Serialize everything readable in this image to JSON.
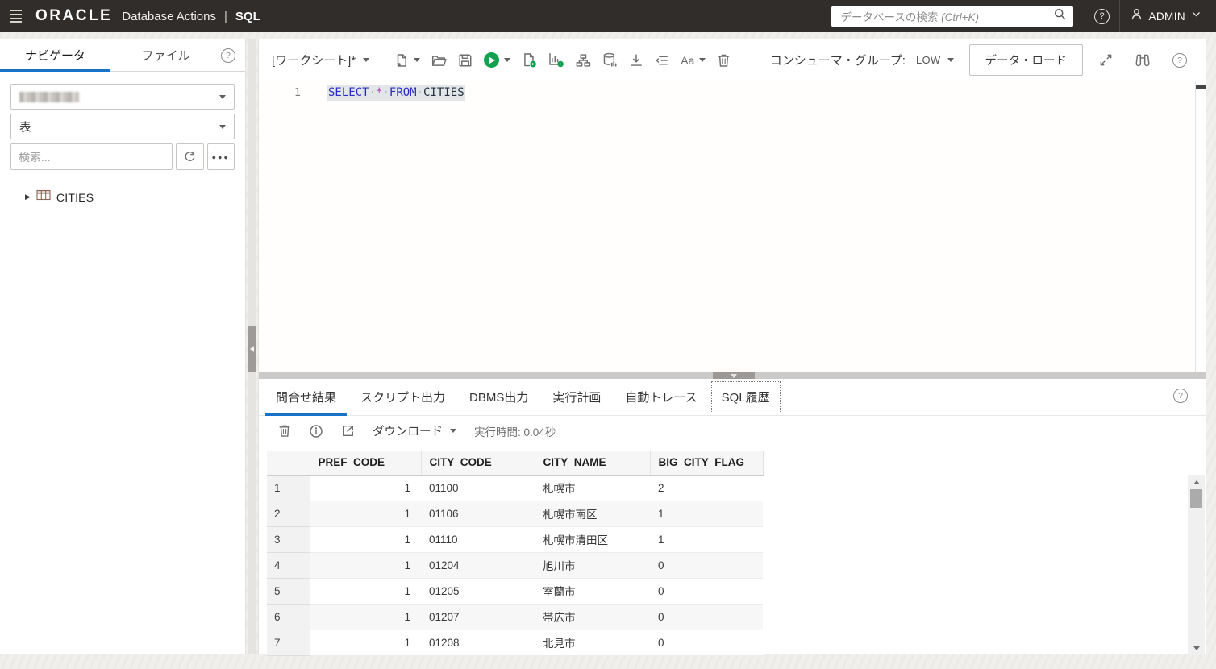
{
  "header": {
    "brand": "ORACLE",
    "app_title": "Database Actions",
    "separator": "|",
    "module": "SQL",
    "search_placeholder": "データベースの検索",
    "search_hint": "(Ctrl+K)",
    "user": "ADMIN"
  },
  "sidebar": {
    "tabs": [
      {
        "label": "ナビゲータ",
        "active": true
      },
      {
        "label": "ファイル",
        "active": false
      }
    ],
    "schema_select": {
      "value": "",
      "redacted": true
    },
    "type_select": {
      "value": "表"
    },
    "search_placeholder": "検索...",
    "tree": [
      {
        "label": "CITIES",
        "type": "table"
      }
    ]
  },
  "worksheet": {
    "tab_label": "[ワークシート]*",
    "consumer_group_label": "コンシューマ・グループ:",
    "consumer_group_value": "LOW",
    "data_load_label": "データ・ロード",
    "font_button_label": "Aa",
    "editor": {
      "line_number": "1",
      "sql": "SELECT * FROM CITIES",
      "tokens": [
        {
          "text": "SELECT",
          "style": "keyword"
        },
        {
          "text": "*",
          "style": "operator"
        },
        {
          "text": "FROM",
          "style": "keyword"
        },
        {
          "text": "CITIES",
          "style": "identifier"
        }
      ]
    }
  },
  "results": {
    "tabs": [
      "問合せ結果",
      "スクリプト出力",
      "DBMS出力",
      "実行計画",
      "自動トレース",
      "SQL履歴"
    ],
    "active_tab": "問合せ結果",
    "focused_tab": "SQL履歴",
    "download_label": "ダウンロード",
    "elapsed_label": "実行時間: 0.04秒",
    "grid": {
      "columns": [
        "PREF_CODE",
        "CITY_CODE",
        "CITY_NAME",
        "BIG_CITY_FLAG"
      ],
      "rows": [
        [
          "1",
          "01100",
          "札幌市",
          "2"
        ],
        [
          "1",
          "01106",
          "札幌市南区",
          "1"
        ],
        [
          "1",
          "01110",
          "札幌市清田区",
          "1"
        ],
        [
          "1",
          "01204",
          "旭川市",
          "0"
        ],
        [
          "1",
          "01205",
          "室蘭市",
          "0"
        ],
        [
          "1",
          "01207",
          "帯広市",
          "0"
        ],
        [
          "1",
          "01208",
          "北見市",
          "0"
        ]
      ]
    }
  },
  "colors": {
    "topbar_bg": "#312d2a",
    "accent_blue": "#1873c8",
    "run_green": "#12a151",
    "keyword_blue": "#2a2ac8",
    "operator_magenta": "#b434b4"
  }
}
